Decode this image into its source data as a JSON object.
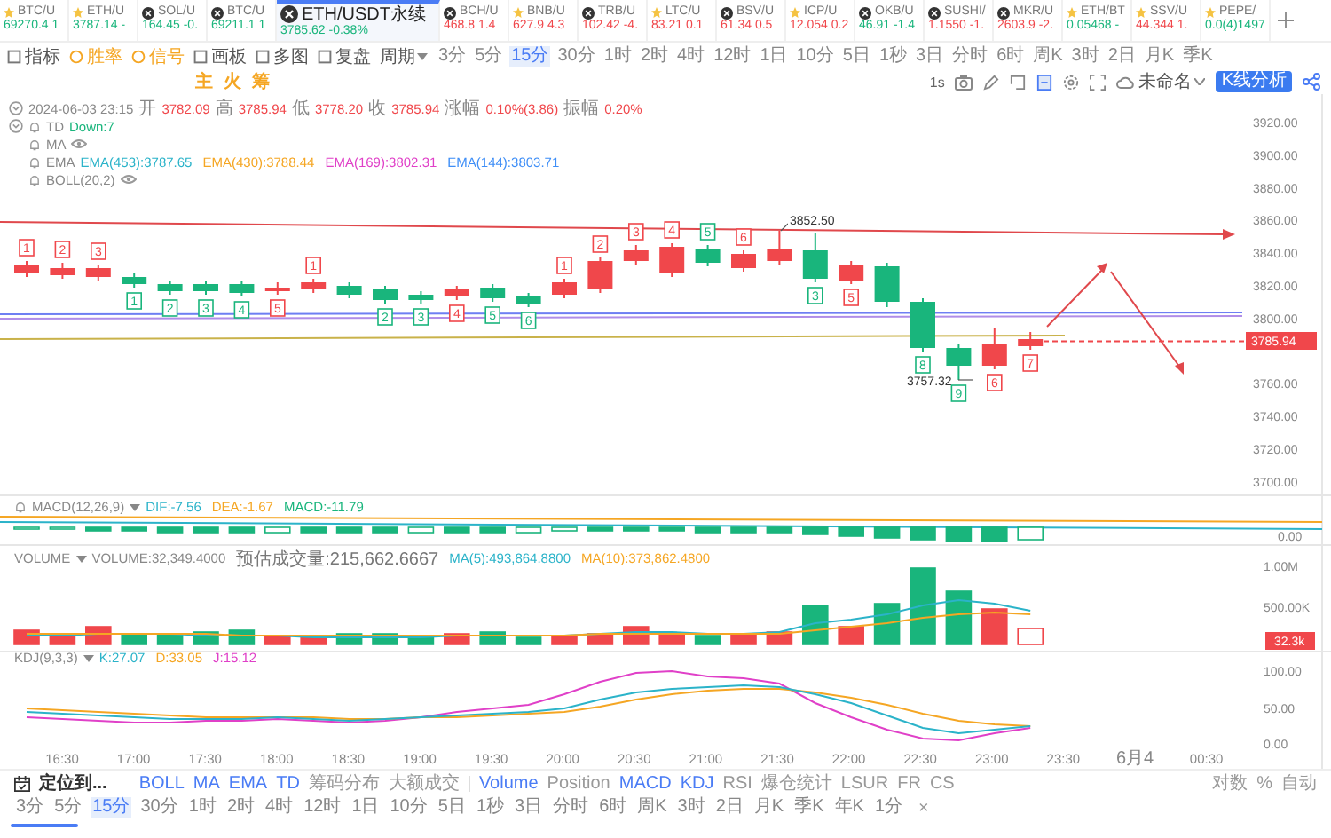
{
  "tickers": [
    {
      "symbol": "BTC/U",
      "quote": "69270.4 1",
      "color": "#19b57c",
      "kind": "star",
      "selected": false
    },
    {
      "symbol": "ETH/U",
      "quote": "3787.14 -",
      "color": "#19b57c",
      "kind": "star",
      "selected": false
    },
    {
      "symbol": "SOL/U",
      "quote": "164.45 -0.",
      "color": "#19b57c",
      "kind": "coin",
      "selected": false
    },
    {
      "symbol": "BTC/U",
      "quote": "69211.1 1",
      "color": "#19b57c",
      "kind": "coin",
      "selected": false
    },
    {
      "symbol": "ETH/USDT永续",
      "quote": "3785.62 -0.38%",
      "color": "#19b57c",
      "kind": "coin",
      "selected": true
    },
    {
      "symbol": "BCH/U",
      "quote": "468.8 1.4",
      "color": "#f0474b",
      "kind": "coin",
      "selected": false
    },
    {
      "symbol": "BNB/U",
      "quote": "627.9 4.3",
      "color": "#f0474b",
      "kind": "star",
      "selected": false
    },
    {
      "symbol": "TRB/U",
      "quote": "102.42 -4.",
      "color": "#f0474b",
      "kind": "coin",
      "selected": false
    },
    {
      "symbol": "LTC/U",
      "quote": "83.21 0.1",
      "color": "#f0474b",
      "kind": "star",
      "selected": false
    },
    {
      "symbol": "BSV/U",
      "quote": "61.34 0.5",
      "color": "#f0474b",
      "kind": "coin",
      "selected": false
    },
    {
      "symbol": "ICP/U",
      "quote": "12.054 0.2",
      "color": "#f0474b",
      "kind": "star",
      "selected": false
    },
    {
      "symbol": "OKB/U",
      "quote": "46.91 -1.4",
      "color": "#19b57c",
      "kind": "coin",
      "selected": false
    },
    {
      "symbol": "SUSHI/",
      "quote": "1.1550 -1.",
      "color": "#f0474b",
      "kind": "coin",
      "selected": false
    },
    {
      "symbol": "MKR/U",
      "quote": "2603.9 -2.",
      "color": "#f0474b",
      "kind": "coin",
      "selected": false
    },
    {
      "symbol": "ETH/BT",
      "quote": "0.05468 -",
      "color": "#19b57c",
      "kind": "star",
      "selected": false
    },
    {
      "symbol": "SSV/U",
      "quote": "44.344 1.",
      "color": "#f0474b",
      "kind": "star",
      "selected": false
    },
    {
      "symbol": "PEPE/",
      "quote": "0.0(4)1497",
      "color": "#19b57c",
      "kind": "star",
      "selected": false
    }
  ],
  "toolbar": {
    "tools": [
      {
        "label": "指标",
        "active": false
      },
      {
        "label": "胜率",
        "active": true
      },
      {
        "label": "信号",
        "active": true
      },
      {
        "label": "画板",
        "active": false
      },
      {
        "label": "多图",
        "active": false
      },
      {
        "label": "复盘",
        "active": false
      }
    ],
    "period_menu": "周期",
    "intervals": [
      {
        "label": "3分",
        "selected": false
      },
      {
        "label": "5分",
        "selected": false
      },
      {
        "label": "15分",
        "selected": true
      },
      {
        "label": "30分",
        "selected": false
      },
      {
        "label": "1时",
        "selected": false
      },
      {
        "label": "2时",
        "selected": false
      },
      {
        "label": "4时",
        "selected": false
      },
      {
        "label": "12时",
        "selected": false
      },
      {
        "label": "1日",
        "selected": false
      },
      {
        "label": "10分",
        "selected": false
      },
      {
        "label": "5日",
        "selected": false
      },
      {
        "label": "1秒",
        "selected": false
      },
      {
        "label": "3日",
        "selected": false
      },
      {
        "label": "分时",
        "selected": false
      },
      {
        "label": "6时",
        "selected": false
      },
      {
        "label": "周K",
        "selected": false
      },
      {
        "label": "3时",
        "selected": false
      },
      {
        "label": "2日",
        "selected": false
      },
      {
        "label": "月K",
        "selected": false
      },
      {
        "label": "季K",
        "selected": false
      }
    ],
    "quick_tabs": [
      "主",
      "火",
      "筹"
    ],
    "tick_interval": "1s",
    "layout_name": "未命名",
    "analysis_button": "K线分析"
  },
  "chart": {
    "ohlc_header": {
      "time": "2024-06-03 23:15",
      "fields": [
        {
          "label": "开",
          "value": "3782.09"
        },
        {
          "label": "高",
          "value": "3785.94"
        },
        {
          "label": "低",
          "value": "3778.20"
        },
        {
          "label": "收",
          "value": "3785.94"
        },
        {
          "label": "涨幅",
          "value": "0.10%(3.86)"
        },
        {
          "label": "振幅",
          "value": "0.20%"
        }
      ]
    },
    "indicators": [
      {
        "name": "TD",
        "hidden": false,
        "values": [
          {
            "text": "Down:7",
            "color": "#19b57c"
          }
        ]
      },
      {
        "name": "MA",
        "hidden": true
      },
      {
        "name": "EMA",
        "hidden": false,
        "values": [
          {
            "text": "EMA(453):3787.65",
            "color": "#2bb3c9"
          },
          {
            "text": "EMA(430):3788.44",
            "color": "#f5a623"
          },
          {
            "text": "EMA(169):3802.31",
            "color": "#e040c8"
          },
          {
            "text": "EMA(144):3803.71",
            "color": "#3e8ef7"
          }
        ]
      },
      {
        "name": "BOLL(20,2)",
        "hidden": true
      }
    ],
    "candles": [
      {
        "rising": true,
        "td_label": "1",
        "td_above": true
      },
      {
        "rising": true,
        "td_label": "2",
        "td_above": true
      },
      {
        "rising": true,
        "td_label": "3",
        "td_above": true
      },
      {
        "rising": false,
        "td_label": "1",
        "td_above": false
      },
      {
        "rising": false,
        "td_label": "2",
        "td_above": false
      },
      {
        "rising": false,
        "td_label": "3",
        "td_above": false
      },
      {
        "rising": false,
        "td_label": "4",
        "td_above": false
      },
      {
        "rising": true,
        "td_label": "5",
        "td_above": false
      },
      {
        "rising": true,
        "td_label": "1",
        "td_above": true
      },
      {
        "rising": false
      },
      {
        "rising": false,
        "td_label": "2",
        "td_above": false
      },
      {
        "rising": false,
        "td_label": "3",
        "td_above": false
      },
      {
        "rising": true,
        "td_label": "4",
        "td_above": false
      },
      {
        "rising": false,
        "td_label": "5",
        "td_above": false
      },
      {
        "rising": false,
        "td_label": "6",
        "td_above": false
      },
      {
        "rising": true,
        "td_label": "1",
        "td_above": true
      },
      {
        "rising": true,
        "td_label": "2",
        "td_above": true
      },
      {
        "rising": true,
        "td_label": "3",
        "td_above": true
      },
      {
        "rising": true,
        "td_label": "4",
        "td_above": true
      },
      {
        "rising": false,
        "td_label": "5",
        "td_above": true
      },
      {
        "rising": true,
        "td_label": "6",
        "td_above": true
      },
      {
        "rising": true
      },
      {
        "rising": false,
        "td_label": "3",
        "td_above": false
      },
      {
        "rising": true,
        "td_label": "5",
        "td_above": false
      },
      {
        "rising": false
      },
      {
        "rising": false,
        "td_label": "8",
        "td_above": false
      },
      {
        "rising": false,
        "td_label": "9",
        "td_above": false
      },
      {
        "rising": true,
        "td_label": "6",
        "td_above": false
      },
      {
        "rising": true,
        "td_label": "7",
        "td_above": false
      }
    ],
    "high_label": "3852.50",
    "low_label": "3757.32",
    "price_axis": [
      "3920.00",
      "3900.00",
      "3880.00",
      "3860.00",
      "3840.00",
      "3820.00",
      "3800.00",
      "3760.00",
      "3740.00",
      "3720.00",
      "3700.00"
    ],
    "current_price": "3785.94",
    "macd": {
      "name": "MACD(12,26,9)",
      "values": [
        {
          "text": "DIF:-7.56",
          "color": "#2bb3c9"
        },
        {
          "text": "DEA:-1.67",
          "color": "#f5a623"
        },
        {
          "text": "MACD:-11.79",
          "color": "#19b57c"
        }
      ],
      "axis": [
        "0.00"
      ]
    },
    "volume": {
      "name": "VOLUME",
      "values": [
        {
          "text": "VOLUME:32,349.4000",
          "color": "#888888"
        },
        {
          "text": "预估成交量:215,662.6667",
          "color": "#777777"
        },
        {
          "text": "MA(5):493,864.8800",
          "color": "#2bb3c9"
        },
        {
          "text": "MA(10):373,862.4800",
          "color": "#f5a623"
        }
      ],
      "axis": [
        "1.00M",
        "500.00K"
      ],
      "current": "32.3k"
    },
    "kdj": {
      "name": "KDJ(9,3,3)",
      "values": [
        {
          "text": "K:27.07",
          "color": "#2bb3c9"
        },
        {
          "text": "D:33.05",
          "color": "#f5a623"
        },
        {
          "text": "J:15.12",
          "color": "#e040c8"
        }
      ],
      "axis": [
        "100.00",
        "50.00",
        "0.00"
      ]
    },
    "time_axis": [
      "16:30",
      "17:00",
      "17:30",
      "18:00",
      "18:30",
      "19:00",
      "19:30",
      "20:00",
      "20:30",
      "21:00",
      "21:30",
      "22:00",
      "22:30",
      "23:00",
      "23:30",
      "6月4",
      "00:30"
    ]
  },
  "bottom_bar": {
    "locate": "定位到...",
    "indicators": [
      {
        "label": "BOLL",
        "active": true
      },
      {
        "label": "MA",
        "active": true
      },
      {
        "label": "EMA",
        "active": true
      },
      {
        "label": "TD",
        "active": true
      },
      {
        "label": "筹码分布",
        "active": false
      },
      {
        "label": "大额成交",
        "active": false
      },
      {
        "label": "Volume",
        "active": true
      },
      {
        "label": "Position",
        "active": false
      },
      {
        "label": "MACD",
        "active": true
      },
      {
        "label": "KDJ",
        "active": true
      },
      {
        "label": "RSI",
        "active": false
      },
      {
        "label": "爆仓统计",
        "active": false
      },
      {
        "label": "LSUR",
        "active": false
      },
      {
        "label": "FR",
        "active": false
      },
      {
        "label": "CS",
        "active": false
      }
    ],
    "scale_options": [
      "对数",
      "%",
      "自动"
    ],
    "intervals": [
      {
        "label": "3分",
        "selected": false
      },
      {
        "label": "5分",
        "selected": false
      },
      {
        "label": "15分",
        "selected": true
      },
      {
        "label": "30分",
        "selected": false
      },
      {
        "label": "1时",
        "selected": false
      },
      {
        "label": "2时",
        "selected": false
      },
      {
        "label": "4时",
        "selected": false
      },
      {
        "label": "12时",
        "selected": false
      },
      {
        "label": "1日",
        "selected": false
      },
      {
        "label": "10分",
        "selected": false
      },
      {
        "label": "5日",
        "selected": false
      },
      {
        "label": "1秒",
        "selected": false
      },
      {
        "label": "3日",
        "selected": false
      },
      {
        "label": "分时",
        "selected": false
      },
      {
        "label": "6时",
        "selected": false
      },
      {
        "label": "周K",
        "selected": false
      },
      {
        "label": "3时",
        "selected": false
      },
      {
        "label": "2日",
        "selected": false
      },
      {
        "label": "月K",
        "selected": false
      },
      {
        "label": "季K",
        "selected": false
      },
      {
        "label": "年K",
        "selected": false
      },
      {
        "label": "1分",
        "selected": false
      }
    ],
    "close": "×"
  }
}
